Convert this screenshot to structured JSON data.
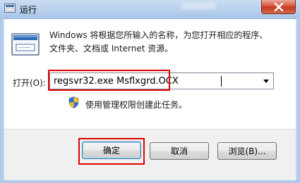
{
  "window": {
    "title": "运行",
    "close_glyph": "✕"
  },
  "dialog": {
    "description_line1": "Windows 将根据您所输入的名称，为您打开相应的程序、",
    "description_line2": "文件夹、文档或 Internet 资源。",
    "open_label": "打开(O):",
    "open_value": "regsvr32.exe Msflxgrd.OCX",
    "admin_note": "使用管理权限创建此任务。",
    "buttons": {
      "ok": "确定",
      "cancel": "取消",
      "browse": "浏览(B)..."
    }
  },
  "icons": [
    "run-app-icon",
    "run-dialog-icon",
    "close-icon",
    "dropdown-arrow-icon",
    "uac-shield-icon"
  ],
  "colors": {
    "highlight": "#e00000",
    "close_button": "#d9543b",
    "titlebar": "#b6cfec"
  }
}
